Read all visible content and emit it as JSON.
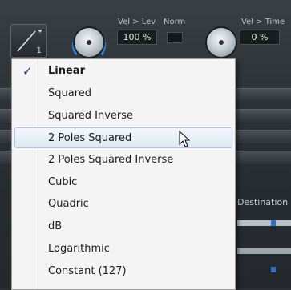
{
  "panel": {
    "curve_index": "1",
    "vel_lev": {
      "label": "Vel > Lev",
      "value": "100 %"
    },
    "norm_label": "Norm",
    "vel_time": {
      "label": "Vel > Time",
      "value": "0 %"
    },
    "destination_label": "Destination"
  },
  "menu": {
    "items": [
      {
        "label": "Linear",
        "checked": true
      },
      {
        "label": "Squared"
      },
      {
        "label": "Squared Inverse"
      },
      {
        "label": "2 Poles Squared",
        "highlighted": true
      },
      {
        "label": "2 Poles Squared Inverse"
      },
      {
        "label": "Cubic"
      },
      {
        "label": "Quadric"
      },
      {
        "label": "dB"
      },
      {
        "label": "Logarithmic"
      },
      {
        "label": "Constant (127)"
      }
    ]
  },
  "colors": {
    "knob_arc": "#2f80d8",
    "menu_highlight": "#dfe8f4",
    "slider_thumb": "#2f73c9"
  },
  "icons": {
    "curve": "linear-curve-icon",
    "check": "check-icon",
    "cursor": "mouse-pointer-icon"
  }
}
